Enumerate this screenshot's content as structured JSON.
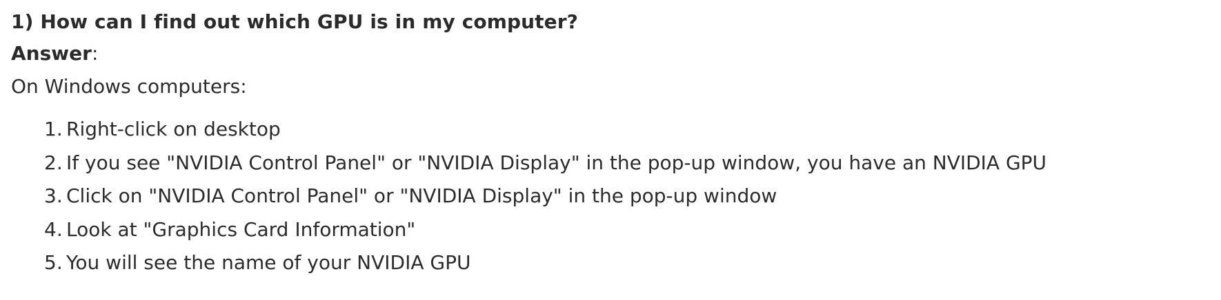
{
  "question": "1) How can I find out which GPU is in my computer?",
  "answer_label": "Answer",
  "answer_colon": ":",
  "intro": "On Windows computers:",
  "steps": [
    {
      "num": "1.",
      "text": "Right-click on desktop"
    },
    {
      "num": "2.",
      "text": "If you see \"NVIDIA Control Panel\" or \"NVIDIA Display\" in the pop-up window, you have an NVIDIA GPU"
    },
    {
      "num": "3.",
      "text": "Click on \"NVIDIA Control Panel\" or \"NVIDIA Display\" in the pop-up window"
    },
    {
      "num": "4.",
      "text": "Look at \"Graphics Card Information\""
    },
    {
      "num": "5.",
      "text": "You will see the name of your NVIDIA GPU"
    }
  ]
}
